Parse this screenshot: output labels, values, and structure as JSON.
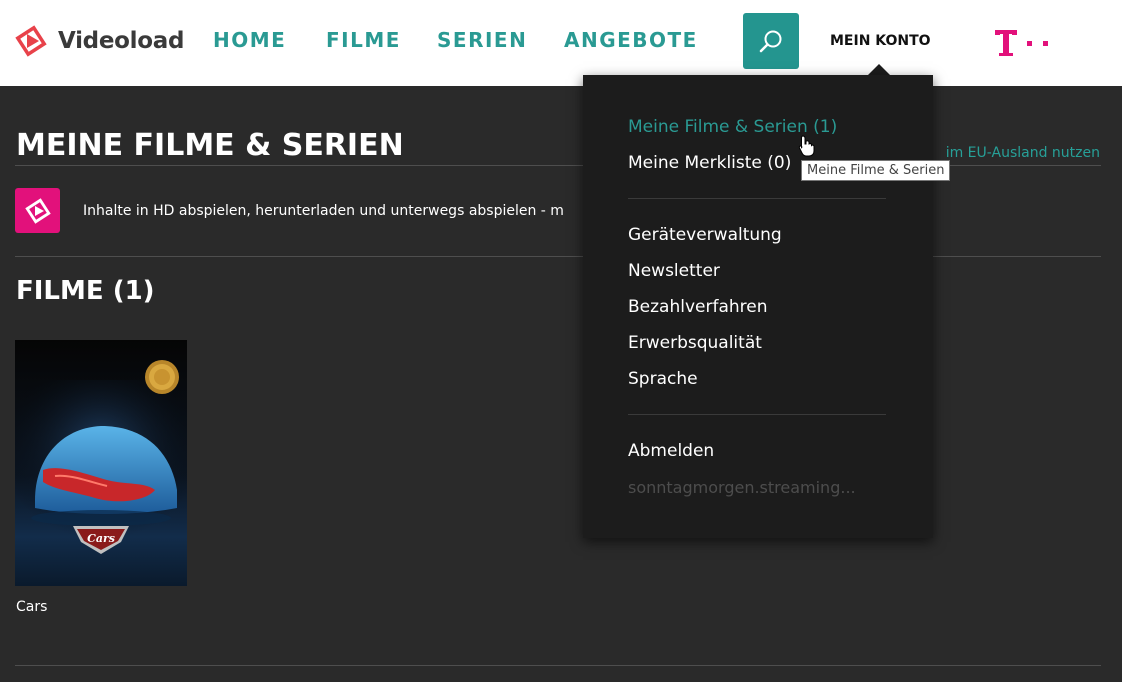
{
  "header": {
    "brand": "Videoload",
    "nav": [
      {
        "label": "HOME"
      },
      {
        "label": "FILME"
      },
      {
        "label": "SERIEN"
      },
      {
        "label": "ANGEBOTE"
      }
    ],
    "account_label": "MEIN KONTO"
  },
  "main": {
    "title": "MEINE FILME & SERIEN",
    "eu_link": "im EU-Ausland nutzen",
    "hd_info": "Inhalte in HD abspielen, herunterladen und unterwegs abspielen - m",
    "section_title": "FILME (1)",
    "movies": [
      {
        "title": "Cars",
        "poster_text": "Cars"
      }
    ]
  },
  "dropdown": {
    "group1": [
      {
        "label": "Meine Filme & Serien (1)"
      },
      {
        "label": "Meine Merkliste (0)"
      }
    ],
    "group2": [
      {
        "label": "Geräteverwaltung"
      },
      {
        "label": "Newsletter"
      },
      {
        "label": "Bezahlverfahren"
      },
      {
        "label": "Erwerbsqualität"
      },
      {
        "label": "Sprache"
      }
    ],
    "logout": "Abmelden",
    "user": "sonntagmorgen.streaming..."
  },
  "tooltip": "Meine Filme & Serien",
  "colors": {
    "accent": "#2a9a93",
    "magenta": "#e2117b",
    "background": "#2a2a2a",
    "dropdown_bg": "#1c1c1c"
  },
  "icons": {
    "brand": "videoload-logo-icon",
    "search": "search-icon",
    "telekom": "telekom-logo-icon",
    "hd": "hd-play-icon",
    "cursor": "hand-cursor-icon"
  }
}
